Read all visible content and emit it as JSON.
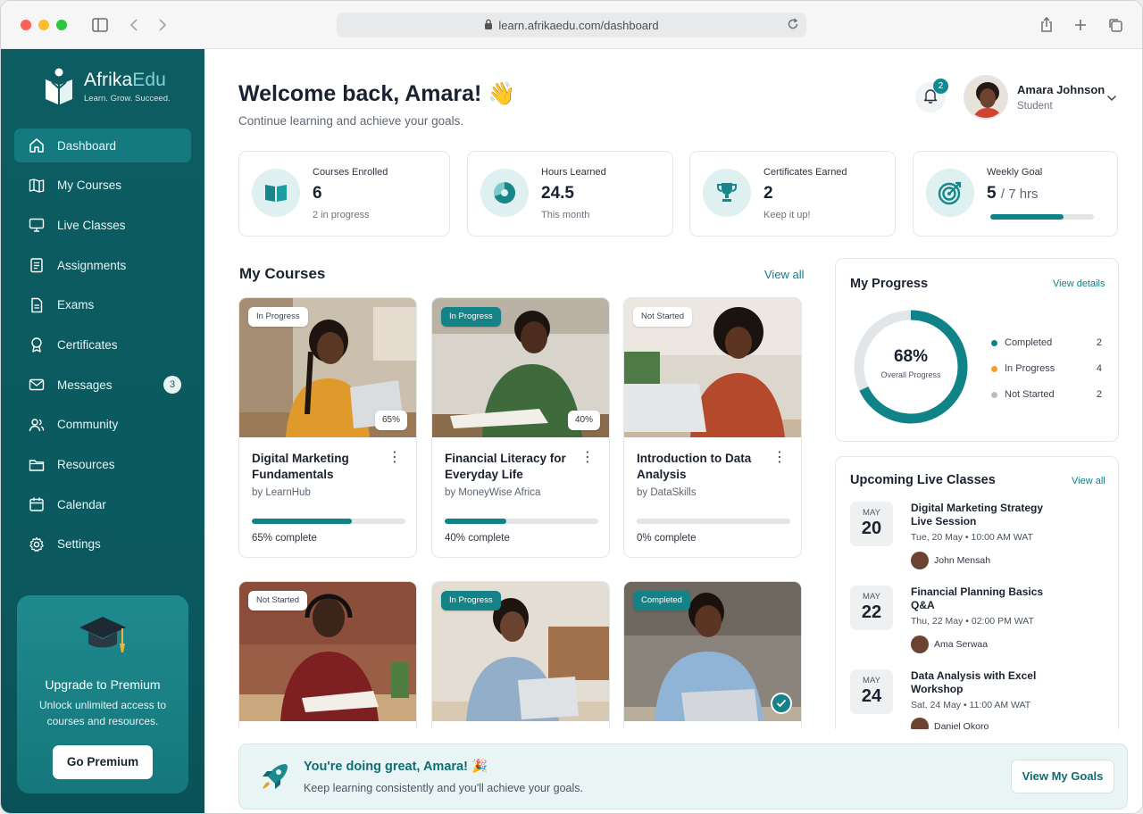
{
  "browser": {
    "url": "learn.afrikaedu.com/dashboard"
  },
  "brand": {
    "name_part1": "Afrika",
    "name_part2": "Edu",
    "tagline": "Learn. Grow. Succeed."
  },
  "sidebar": {
    "items": [
      {
        "label": "Dashboard",
        "icon": "home-icon",
        "active": true
      },
      {
        "label": "My Courses",
        "icon": "book-icon"
      },
      {
        "label": "Live Classes",
        "icon": "monitor-icon"
      },
      {
        "label": "Assignments",
        "icon": "clipboard-icon"
      },
      {
        "label": "Exams",
        "icon": "document-icon"
      },
      {
        "label": "Certificates",
        "icon": "award-icon"
      },
      {
        "label": "Messages",
        "icon": "mail-icon",
        "badge": "3"
      },
      {
        "label": "Community",
        "icon": "users-icon"
      },
      {
        "label": "Resources",
        "icon": "folder-icon"
      },
      {
        "label": "Calendar",
        "icon": "calendar-icon"
      },
      {
        "label": "Settings",
        "icon": "gear-icon"
      }
    ],
    "premium": {
      "title": "Upgrade to Premium",
      "text": "Unlock unlimited access to courses and resources.",
      "button": "Go Premium"
    }
  },
  "header": {
    "welcome": "Welcome back, Amara! 👋",
    "subtitle": "Continue learning and achieve your goals.",
    "notifications": "2",
    "user": {
      "name": "Amara Johnson",
      "role": "Student"
    }
  },
  "stats": [
    {
      "label": "Courses Enrolled",
      "value": "6",
      "note": "2 in progress",
      "icon": "book-open-icon"
    },
    {
      "label": "Hours Learned",
      "value": "24.5",
      "note": "This month",
      "icon": "pie-chart-icon"
    },
    {
      "label": "Certificates Earned",
      "value": "2",
      "note": "Keep it up!",
      "icon": "trophy-icon"
    },
    {
      "label": "Weekly Goal",
      "value": "5",
      "value_suffix": "/ 7 hrs",
      "progress": 0.71,
      "icon": "target-icon"
    }
  ],
  "courses": {
    "title": "My Courses",
    "view_all": "View all",
    "items": [
      {
        "status": "In Progress",
        "badge_pct": "65%",
        "title": "Digital Marketing Fundamentals",
        "by": "by LearnHub",
        "progress": 0.65,
        "progress_text": "65% complete"
      },
      {
        "status": "In Progress",
        "badge_pct": "40%",
        "title": "Financial Literacy for Everyday Life",
        "by": "by MoneyWise Africa",
        "progress": 0.4,
        "progress_text": "40% complete"
      },
      {
        "status": "Not Started",
        "title": "Introduction to Data Analysis",
        "by": "by DataSkills",
        "progress": 0,
        "progress_text": "0% complete"
      },
      {
        "status": "Not Started"
      },
      {
        "status": "In Progress"
      },
      {
        "status": "Completed"
      }
    ]
  },
  "progress": {
    "title": "My Progress",
    "link": "View details",
    "percent": "68%",
    "percent_value": 0.68,
    "caption": "Overall Progress",
    "legend": [
      {
        "label": "Completed",
        "value": "2",
        "color": "#108388"
      },
      {
        "label": "In Progress",
        "value": "4",
        "color": "#f0a030"
      },
      {
        "label": "Not Started",
        "value": "2",
        "color": "#b8bec4"
      }
    ]
  },
  "live": {
    "title": "Upcoming Live Classes",
    "link": "View all",
    "items": [
      {
        "month": "MAY",
        "day": "20",
        "title": "Digital Marketing Strategy Live Session",
        "when": "Tue, 20 May  •  10:00 AM WAT",
        "host": "John Mensah"
      },
      {
        "month": "MAY",
        "day": "22",
        "title": "Financial Planning Basics Q&A",
        "when": "Thu, 22 May  •  02:00 PM WAT",
        "host": "Ama Serwaa"
      },
      {
        "month": "MAY",
        "day": "24",
        "title": "Data Analysis with Excel Workshop",
        "when": "Sat, 24 May  •  11:00 AM WAT",
        "host": "Daniel Okoro"
      }
    ]
  },
  "banner": {
    "title": "You're doing great, Amara! 🎉",
    "text": "Keep learning consistently and you'll achieve your goals.",
    "button": "View My Goals"
  },
  "colors": {
    "primary": "#0c5c62",
    "accent": "#108388"
  }
}
